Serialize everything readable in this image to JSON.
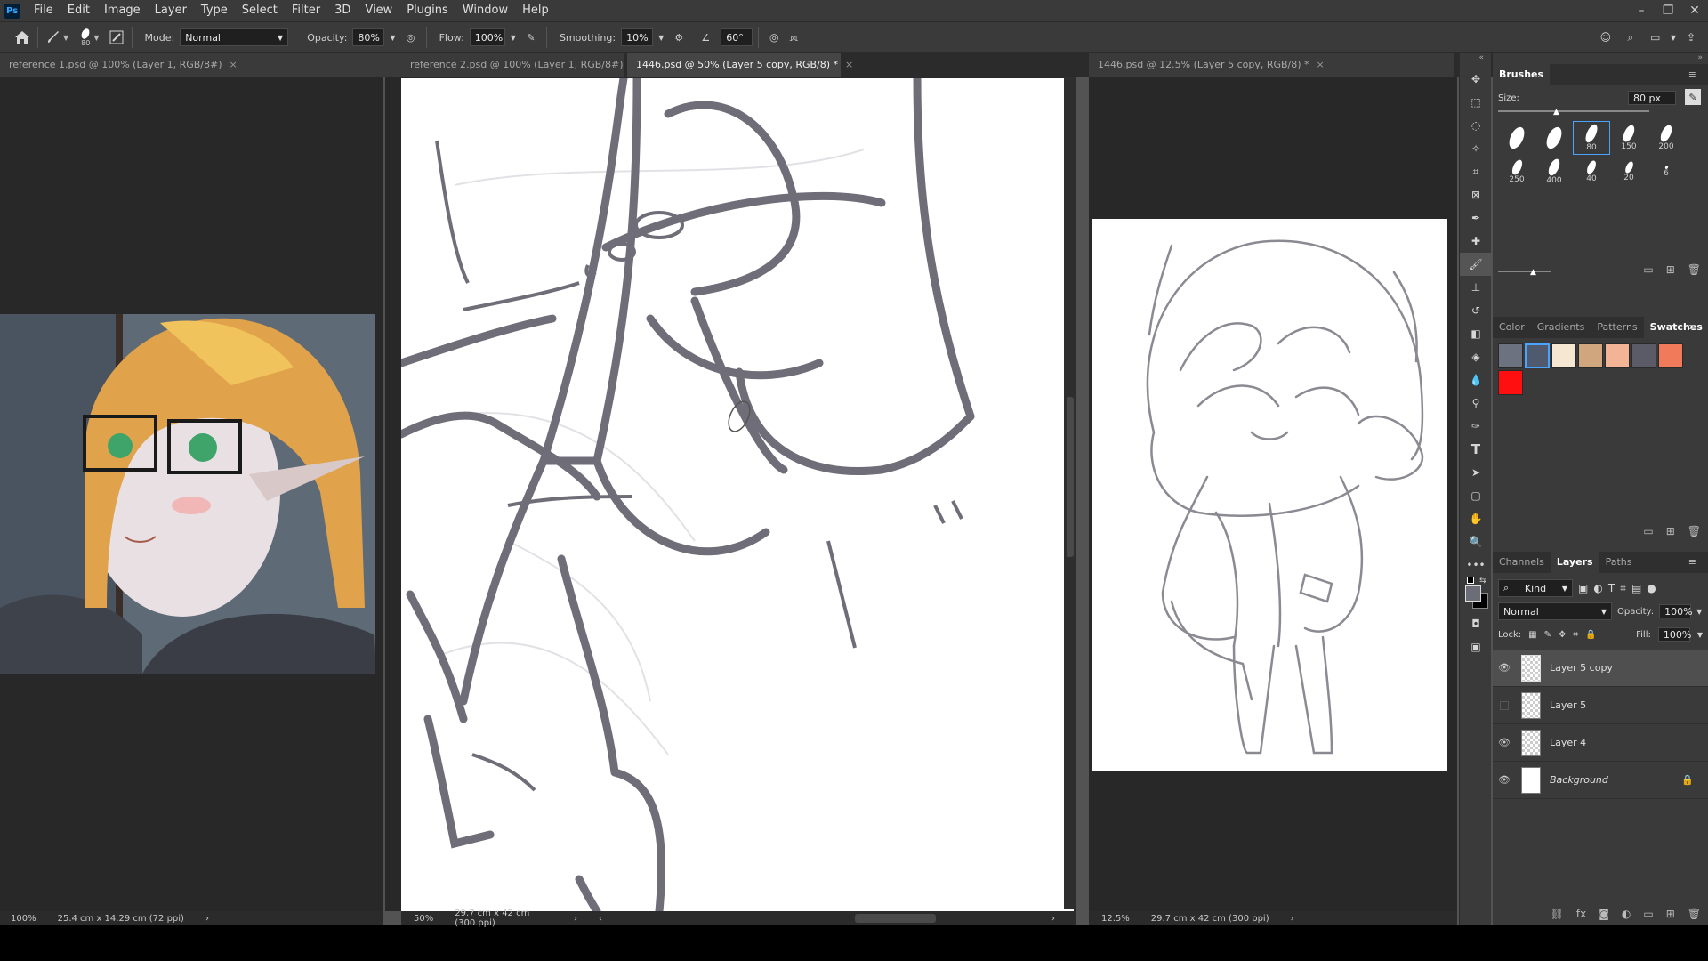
{
  "app": {
    "logo": "Ps"
  },
  "menu": [
    "File",
    "Edit",
    "Image",
    "Layer",
    "Type",
    "Select",
    "Filter",
    "3D",
    "View",
    "Plugins",
    "Window",
    "Help"
  ],
  "options": {
    "brush_size": "80",
    "mode_label": "Mode:",
    "mode": "Normal",
    "opacity_label": "Opacity:",
    "opacity": "80%",
    "flow_label": "Flow:",
    "flow": "100%",
    "smoothing_label": "Smoothing:",
    "smoothing": "10%",
    "angle": "60°"
  },
  "tabs": [
    {
      "label": "reference 1.psd @ 100% (Layer 1, RGB/8#)"
    },
    {
      "label": "reference 2.psd @ 100% (Layer 1, RGB/8#)"
    },
    {
      "label": "1446.psd @ 50% (Layer 5 copy, RGB/8) *"
    },
    {
      "label": "1446.psd @ 12.5% (Layer 5 copy, RGB/8) *"
    }
  ],
  "status": [
    {
      "zoom": "100%",
      "size": "25.4 cm x 14.29 cm (72 ppi)"
    },
    {
      "zoom": "50%",
      "size": "29.7 cm x 42 cm (300 ppi)"
    },
    {
      "zoom": "12.5%",
      "size": "29.7 cm x 42 cm (300 ppi)"
    }
  ],
  "brushes": {
    "title": "Brushes",
    "size_label": "Size:",
    "size_value": "80 px",
    "presets": [
      "",
      "",
      "80",
      "150",
      "200",
      "250",
      "400",
      "40",
      "20",
      "6"
    ]
  },
  "color_tabs": [
    "Color",
    "Gradients",
    "Patterns",
    "Swatches"
  ],
  "swatches": [
    "#6d7280",
    "#4f5a6e",
    "#f6e7d2",
    "#cfa67e",
    "#f2b494",
    "#5b5b68",
    "#f07a5a",
    "#ff0f0f"
  ],
  "layer_tabs": [
    "Channels",
    "Layers",
    "Paths"
  ],
  "layers_panel": {
    "kind": "Kind",
    "blend": "Normal",
    "opacity_label": "Opacity:",
    "opacity": "100%",
    "lock_label": "Lock:",
    "fill_label": "Fill:",
    "fill": "100%"
  },
  "layers": [
    {
      "name": "Layer 5 copy",
      "visible": true
    },
    {
      "name": "Layer 5",
      "visible": false
    },
    {
      "name": "Layer 4",
      "visible": true
    },
    {
      "name": "Background",
      "visible": true
    }
  ]
}
